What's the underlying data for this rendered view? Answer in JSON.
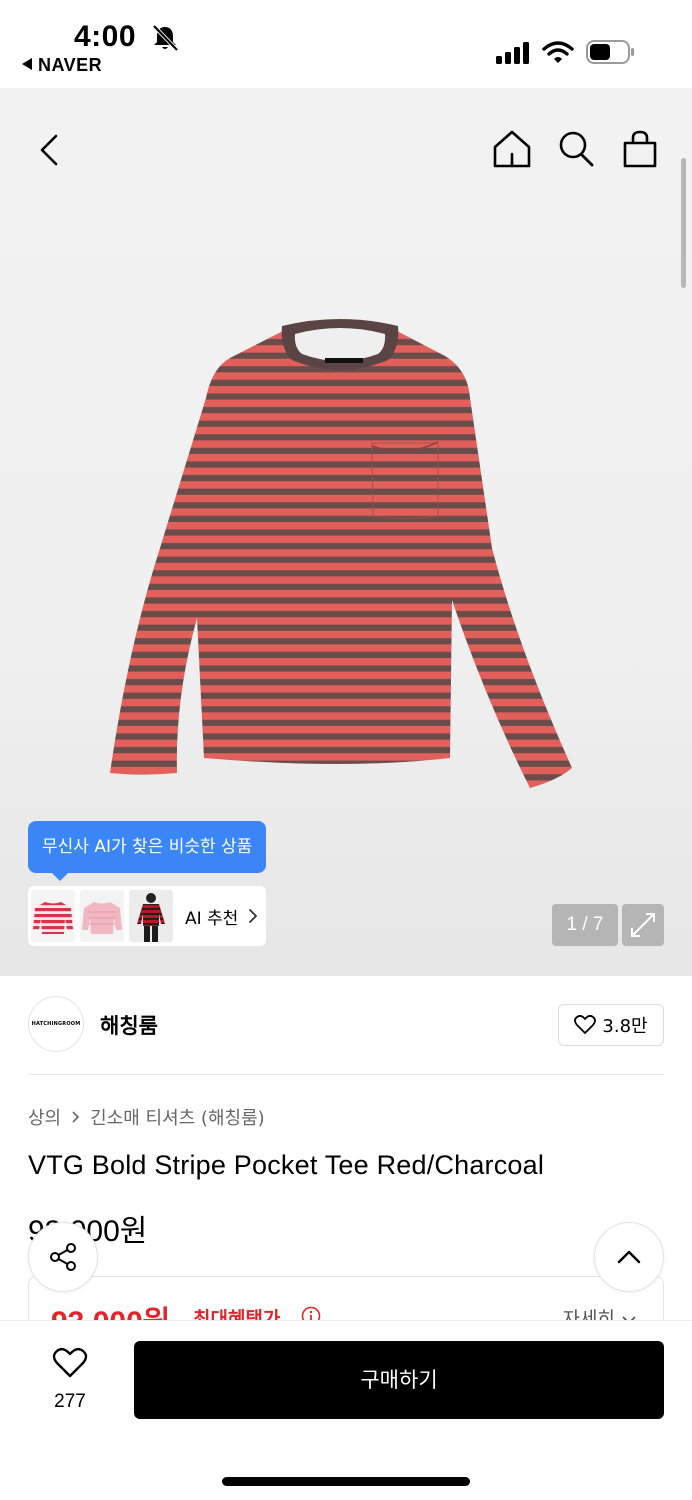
{
  "status_bar": {
    "time": "4:00",
    "back_app": "NAVER",
    "icons": [
      "bell-off-icon",
      "signal-icon",
      "wifi-icon",
      "battery-icon"
    ]
  },
  "nav": {
    "icons": [
      "chevron-left-icon",
      "home-icon",
      "search-icon",
      "shopping-bag-icon"
    ]
  },
  "gallery": {
    "counter": "1 / 7",
    "ai_tooltip": "무신사 AI가 찾은 비슷한 상품",
    "ai_label": "AI 추천"
  },
  "brand": {
    "logo_text": "HATCHINGROOM",
    "name": "해칭룸",
    "likes": "3.8만"
  },
  "breadcrumb": {
    "items": [
      "상의",
      "긴소매 티셔츠 (해칭룸)"
    ]
  },
  "product": {
    "title": "VTG Bold Stripe Pocket Tee Red/Charcoal",
    "price": "93,000원",
    "benefit_price": "93,000원",
    "benefit_label": "최대혜택가",
    "detail_label": "자세히"
  },
  "bottom_bar": {
    "wish_count": "277",
    "buy_label": "구매하기"
  },
  "colors": {
    "accent_blue": "#3a86f7",
    "sale_red": "#e0262b",
    "stripe_red": "#e25d5a",
    "stripe_charcoal": "#5b4a4a"
  }
}
